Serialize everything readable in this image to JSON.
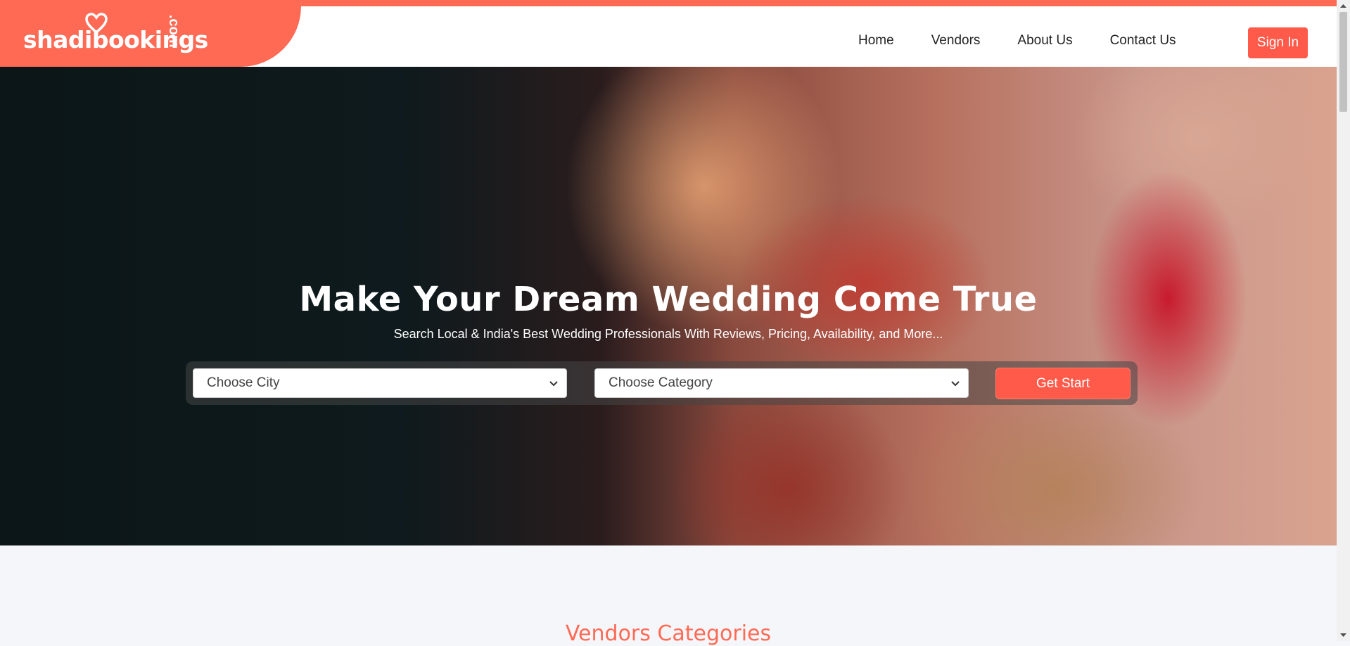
{
  "brand": {
    "logo_text": "shadibookings",
    "logo_suffix": ".com",
    "accent": "#ff6a55",
    "button_color": "#ff5a4a"
  },
  "nav": {
    "items": [
      {
        "label": "Home"
      },
      {
        "label": "Vendors"
      },
      {
        "label": "About Us"
      },
      {
        "label": "Contact Us"
      }
    ],
    "signin_label": "Sign In"
  },
  "hero": {
    "title": "Make Your Dream Wedding Come True",
    "subtitle": "Search Local & India's Best Wedding Professionals With Reviews, Pricing, Availability, and More...",
    "city_select": "Choose City",
    "category_select": "Choose Category",
    "cta_label": "Get Start"
  },
  "section": {
    "title": "Vendors Categories"
  }
}
